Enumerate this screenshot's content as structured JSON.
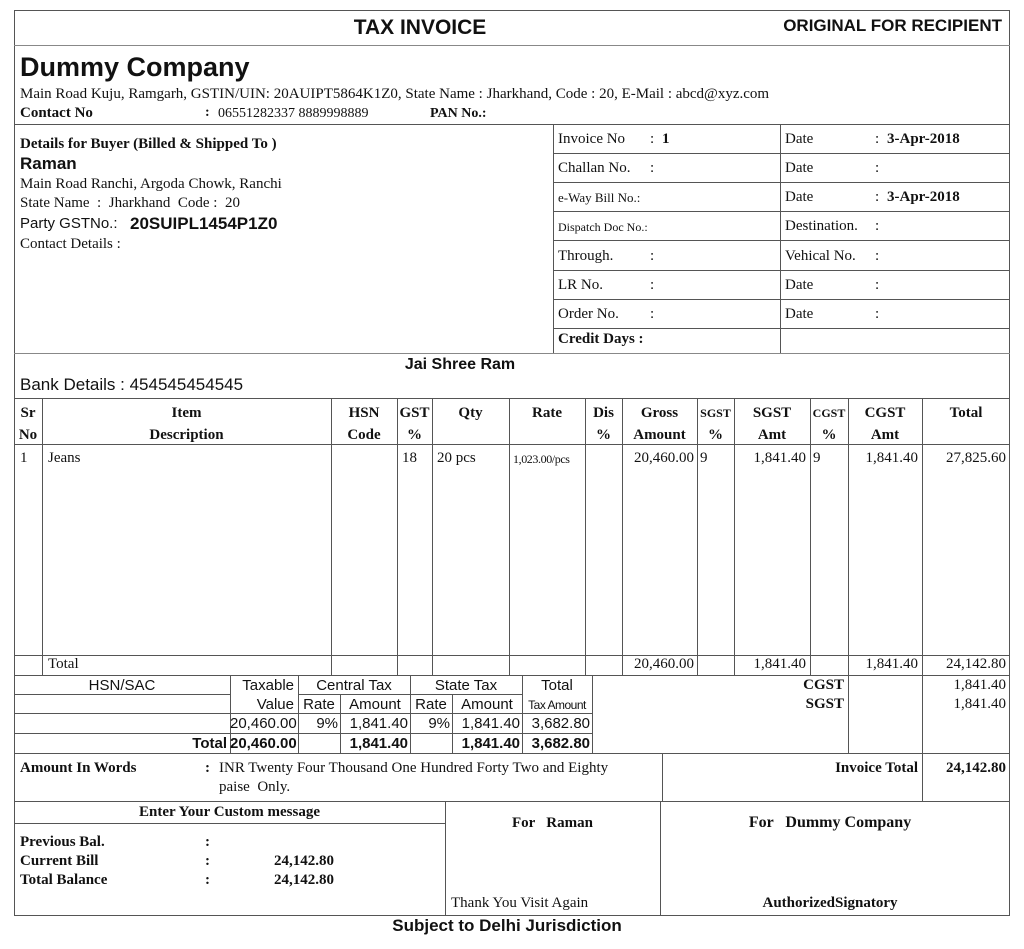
{
  "header": {
    "title": "TAX INVOICE",
    "copy_label": "ORIGINAL FOR RECIPIENT"
  },
  "company": {
    "name": "Dummy Company",
    "address_line": "Main Road Kuju, Ramgarh, GSTIN/UIN: 20AUIPT5864K1Z0, State Name :  Jharkhand, Code : 20, E-Mail : abcd@xyz.com",
    "contact_label": "Contact No",
    "contact_sep": ":",
    "contact_value": "06551282337  8889998889",
    "pan_label": "PAN No.:"
  },
  "buyer": {
    "heading": "Details for Buyer (Billed & Shipped To )",
    "name": "Raman",
    "address": "Main Road Ranchi, Argoda Chowk, Ranchi",
    "state_line": "State Name  :  Jharkhand  Code :  20",
    "gst_label": "Party GSTNo.:",
    "gst_value": "20SUIPL1454P1Z0",
    "contact_label": "Contact Details :"
  },
  "invoice_meta": {
    "rows": [
      {
        "left_label": "Invoice No",
        "left_sep": ":",
        "left_value": "1",
        "right_label": "Date",
        "right_sep": ":",
        "right_value": "3-Apr-2018"
      },
      {
        "left_label": "Challan No.",
        "left_sep": ":",
        "left_value": "",
        "right_label": "Date",
        "right_sep": ":",
        "right_value": ""
      },
      {
        "left_label": "e-Way Bill No.:",
        "left_sep": "",
        "left_value": "",
        "right_label": "Date",
        "right_sep": ":",
        "right_value": "3-Apr-2018"
      },
      {
        "left_label": "Dispatch Doc No.:",
        "left_sep": "",
        "left_value": "",
        "right_label": "Destination.",
        "right_sep": ":",
        "right_value": ""
      },
      {
        "left_label": "Through.",
        "left_sep": ":",
        "left_value": "",
        "right_label": "Vehical No.",
        "right_sep": ":",
        "right_value": ""
      },
      {
        "left_label": "LR No.",
        "left_sep": ":",
        "left_value": "",
        "right_label": "Date",
        "right_sep": ":",
        "right_value": ""
      },
      {
        "left_label": "Order No.",
        "left_sep": ":",
        "left_value": "",
        "right_label": "Date",
        "right_sep": ":",
        "right_value": ""
      }
    ],
    "credit_days_label": "Credit Days :"
  },
  "greeting": "Jai Shree Ram",
  "bank_details": "Bank Details : 454545454545",
  "items_table": {
    "headers": [
      {
        "l1": "Sr",
        "l2": "No"
      },
      {
        "l1": "Item",
        "l2": "Description"
      },
      {
        "l1": "HSN",
        "l2": "Code"
      },
      {
        "l1": "GST",
        "l2": "%"
      },
      {
        "l1": "Qty",
        "l2": ""
      },
      {
        "l1": "Rate",
        "l2": ""
      },
      {
        "l1": "Dis",
        "l2": "%"
      },
      {
        "l1": "Gross",
        "l2": "Amount"
      },
      {
        "l1": "SGST",
        "l2": "%"
      },
      {
        "l1": "SGST",
        "l2": "Amt"
      },
      {
        "l1": "CGST",
        "l2": "%"
      },
      {
        "l1": "CGST",
        "l2": "Amt"
      },
      {
        "l1": "Total",
        "l2": ""
      }
    ],
    "rows": [
      {
        "sr": "1",
        "description": "Jeans",
        "hsn": "",
        "gst": "18",
        "qty": "20 pcs",
        "rate": "1,023.00/pcs",
        "dis": "",
        "gross": "20,460.00",
        "sgst_pct": "9",
        "sgst_amt": "1,841.40",
        "cgst_pct": "9",
        "cgst_amt": "1,841.40",
        "total": "27,825.60"
      }
    ],
    "total_row": {
      "label": "Total",
      "gross": "20,460.00",
      "sgst_amt": "1,841.40",
      "cgst_amt": "1,841.40",
      "total": "24,142.80"
    }
  },
  "hsn_summary": {
    "headers": {
      "hsn": "HSN/SAC",
      "taxable_l1": "Taxable",
      "taxable_l2": "Value",
      "central": "Central Tax",
      "state": "State Tax",
      "rate": "Rate",
      "amount": "Amount",
      "total_l1": "Total",
      "total_l2": "Tax Amount"
    },
    "rows": [
      {
        "hsn": "",
        "taxable": "20,460.00",
        "c_rate": "9%",
        "c_amt": "1,841.40",
        "s_rate": "9%",
        "s_amt": "1,841.40",
        "total_tax": "3,682.80"
      }
    ],
    "total_row": {
      "label": "Total",
      "taxable": "20,460.00",
      "c_amt": "1,841.40",
      "s_amt": "1,841.40",
      "total_tax": "3,682.80"
    }
  },
  "tax_totals": [
    {
      "label": "CGST",
      "value": "1,841.40"
    },
    {
      "label": "SGST",
      "value": "1,841.40"
    }
  ],
  "amount_words": {
    "label": "Amount In Words",
    "sep": ":",
    "line1": "INR Twenty Four Thousand One Hundred Forty Two and Eighty",
    "line2": "paise  Only."
  },
  "invoice_total": {
    "label": "Invoice Total",
    "value": "24,142.80"
  },
  "custom_message": "Enter Your Custom message",
  "balances": [
    {
      "label": "Previous Bal.",
      "sep": ":",
      "value": ""
    },
    {
      "label": "Current Bill",
      "sep": ":",
      "value": "24,142.80"
    },
    {
      "label": "Total Balance",
      "sep": ":",
      "value": "24,142.80"
    }
  ],
  "sign_buyer": {
    "for_label": "For   Raman",
    "note": "Thank You Visit Again"
  },
  "sign_company": {
    "for_label": "For   Dummy Company",
    "signatory": "AuthorizedSignatory"
  },
  "jurisdiction": "Subject to Delhi Jurisdiction"
}
